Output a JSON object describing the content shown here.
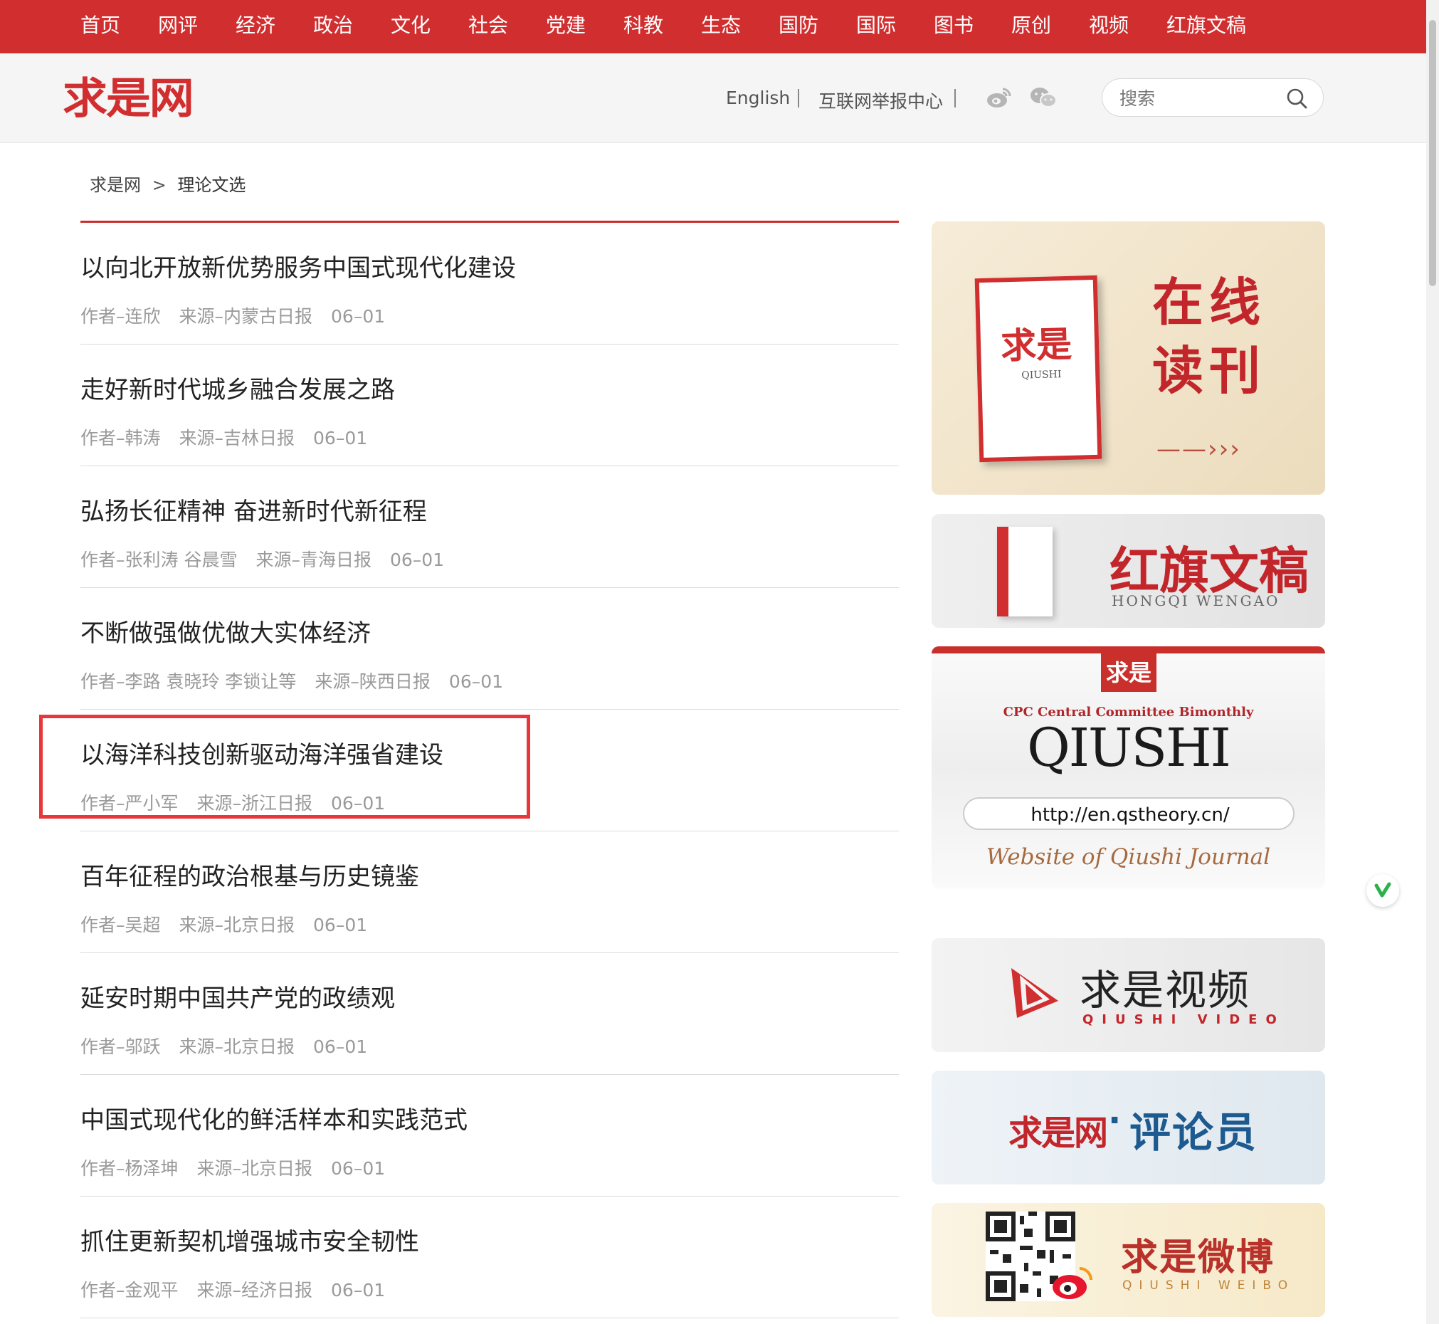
{
  "nav": {
    "items": [
      "首页",
      "网评",
      "经济",
      "政治",
      "文化",
      "社会",
      "党建",
      "科教",
      "生态",
      "国防",
      "国际",
      "图书",
      "原创",
      "视频",
      "红旗文稿"
    ]
  },
  "header": {
    "logo": "求是网",
    "links": [
      "English",
      "互联网举报中心"
    ],
    "social_icons": [
      "weibo-icon",
      "wechat-icon"
    ],
    "search": {
      "placeholder": "搜索"
    }
  },
  "breadcrumb": {
    "home": "求是网",
    "separator": ">",
    "current": "理论文选"
  },
  "articles": [
    {
      "title": "以向北开放新优势服务中国式现代化建设",
      "author": "作者–连欣",
      "source": "来源–内蒙古日报",
      "date": "06–01"
    },
    {
      "title": "走好新时代城乡融合发展之路",
      "author": "作者–韩涛",
      "source": "来源–吉林日报",
      "date": "06–01"
    },
    {
      "title": "弘扬长征精神 奋进新时代新征程",
      "author": "作者–张利涛 谷晨雪",
      "source": "来源–青海日报",
      "date": "06–01"
    },
    {
      "title": "不断做强做优做大实体经济",
      "author": "作者–李路 袁晓玲 李锁让等",
      "source": "来源–陕西日报",
      "date": "06–01"
    },
    {
      "title": "以海洋科技创新驱动海洋强省建设",
      "author": "作者–严小军",
      "source": "来源–浙江日报",
      "date": "06–01"
    },
    {
      "title": "百年征程的政治根基与历史镜鉴",
      "author": "作者–吴超",
      "source": "来源–北京日报",
      "date": "06–01"
    },
    {
      "title": "延安时期中国共产党的政绩观",
      "author": "作者–邬跃",
      "source": "来源–北京日报",
      "date": "06–01"
    },
    {
      "title": "中国式现代化的鲜活样本和实践范式",
      "author": "作者–杨泽坤",
      "source": "来源–北京日报",
      "date": "06–01"
    },
    {
      "title": "抓住更新契机增强城市安全韧性",
      "author": "作者–金观平",
      "source": "来源–经济日报",
      "date": "06–01"
    }
  ],
  "sidebar": {
    "read": {
      "magazine_title": "求是",
      "magazine_sub": "QIUSHI",
      "title": "在线读刊",
      "arrow": "——›››"
    },
    "hongqi": {
      "title": "红旗文稿",
      "sub": "HONGQI WENGAO"
    },
    "qiushi_en": {
      "seal": "求是",
      "cpc": "CPC Central Committee Bimonthly",
      "big": "QIUSHI",
      "url": "http://en.qstheory.cn/",
      "website": "Website of Qiushi Journal"
    },
    "video": {
      "title": "求是视频",
      "sub": "QIUSHI VIDEO"
    },
    "comment": {
      "logo": "求是网",
      "dot": "·",
      "title": "评论员"
    },
    "weibo": {
      "title": "求是微博",
      "sub": "QIUSHI WEIBO"
    }
  },
  "colors": {
    "brand_red": "#d12e2f",
    "highlight": "#e8363a",
    "meta_gray": "#9a9a9a"
  }
}
